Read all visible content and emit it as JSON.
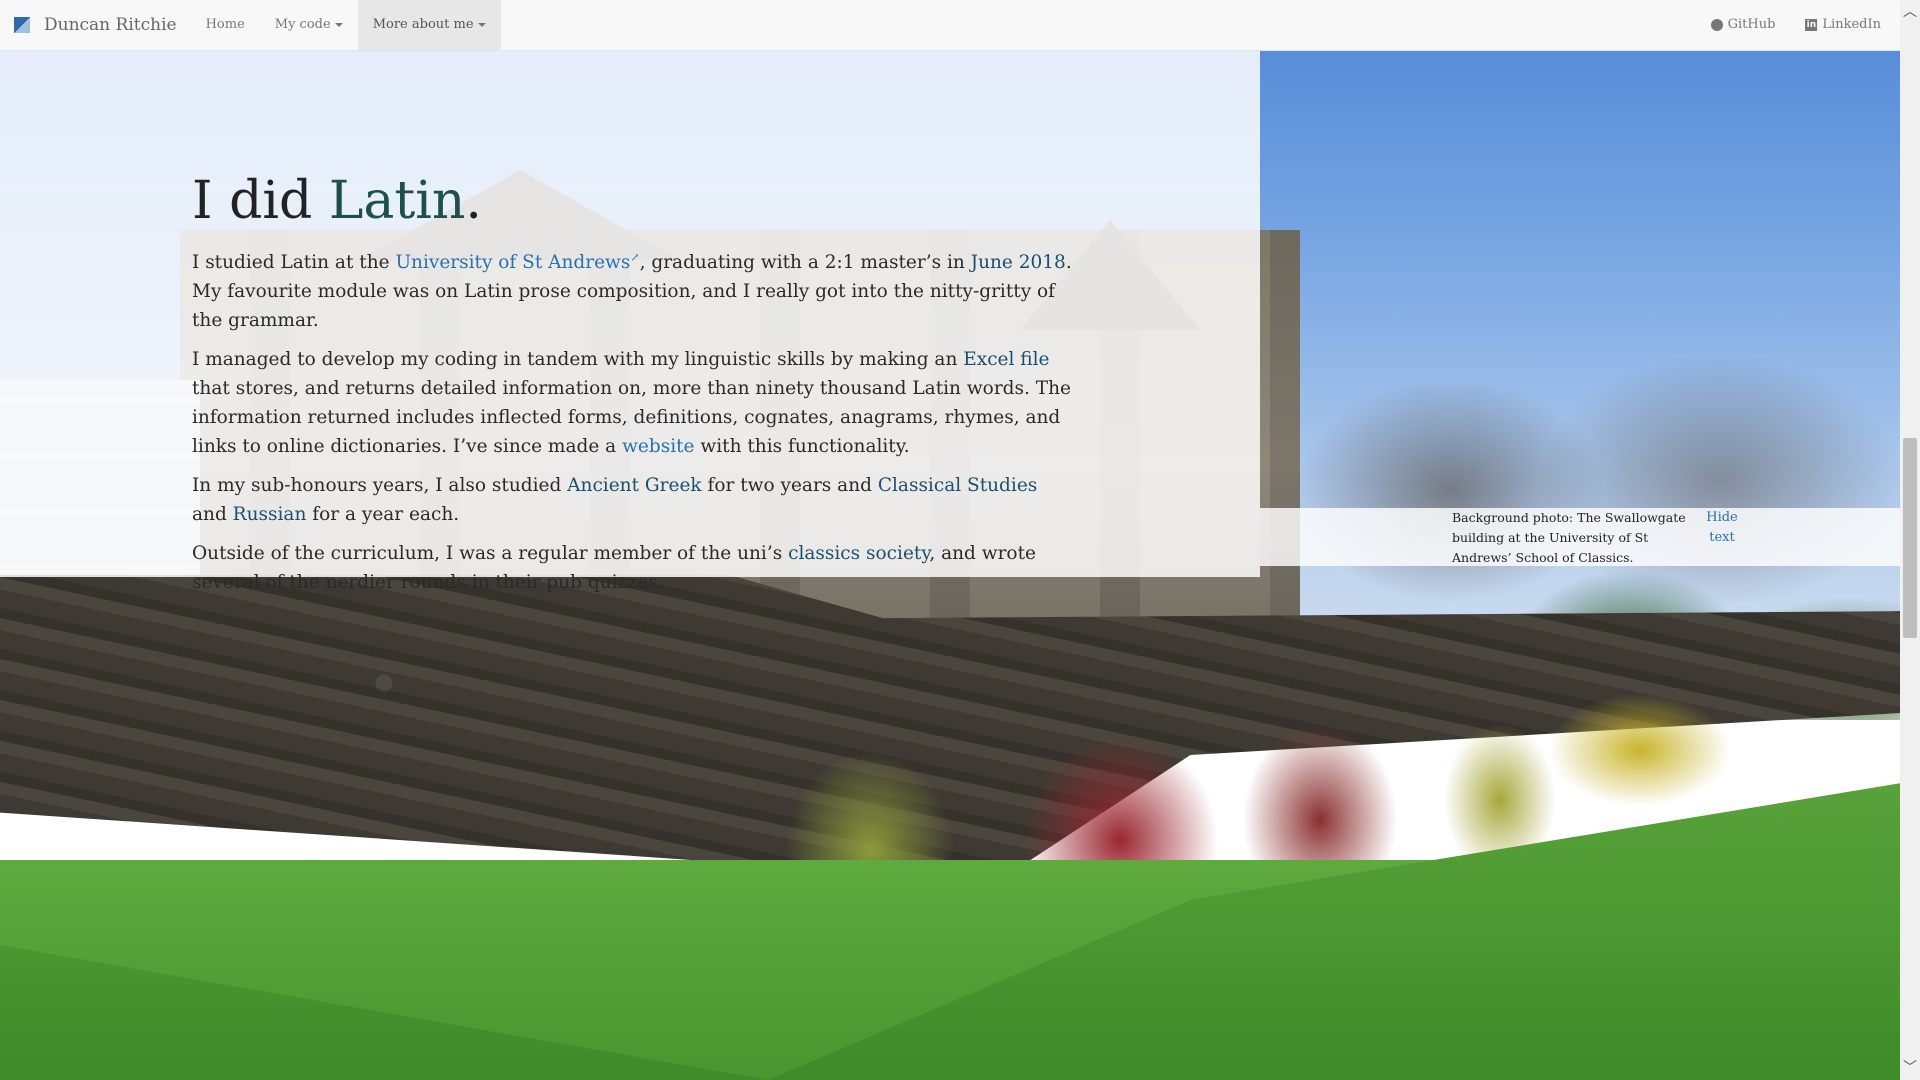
{
  "navbar": {
    "brand": "Duncan Ritchie",
    "items": [
      {
        "label": "Home"
      },
      {
        "label": "My code"
      },
      {
        "label": "More about me"
      }
    ],
    "right": [
      {
        "label": "GitHub",
        "icon": "github-icon"
      },
      {
        "label": "LinkedIn",
        "icon": "linkedin-icon"
      }
    ]
  },
  "main": {
    "heading_pre": "I did ",
    "heading_highlight": "Latin",
    "heading_post": ".",
    "p1": {
      "t1": "I studied Latin at the ",
      "link1": "University of St Andrews",
      "t2": ", graduating with a 2:1 master’s in ",
      "link2": "June 2018",
      "t3": ". My favourite module was on Latin prose composition, and I really got into the nitty-gritty of the grammar."
    },
    "p2": {
      "t1": "I managed to develop my coding in tandem with my linguistic skills by making an ",
      "link1": "Excel file",
      "t2": " that stores, and returns detailed information on, more than ninety thousand Latin words. The information returned includes inflected forms, definitions, cognates, anagrams, rhymes, and links to online dictionaries. I’ve since made a ",
      "link2": "website",
      "t3": " with this functionality."
    },
    "p3": {
      "t1": "In my sub-honours years, I also studied ",
      "link1": "Ancient Greek",
      "t2": " for two years and ",
      "link2": "Classical Studies",
      "t3": " and ",
      "link3": "Russian",
      "t4": " for a year each."
    },
    "p4": {
      "t1": "Outside of the curriculum, I was a regular member of the uni’s ",
      "link1": "classics society",
      "t2": ", and wrote several of the nerdier rounds in their pub quizzes."
    }
  },
  "caption": {
    "text": "Background photo: The Swallowgate building at the University of St Andrews’ School of Classics.",
    "hide_label": "Hide text"
  },
  "colors": {
    "navbar_bg": "#f8f8f8",
    "link_teal": "#1a4f6e",
    "link_blue": "#2671b0"
  }
}
